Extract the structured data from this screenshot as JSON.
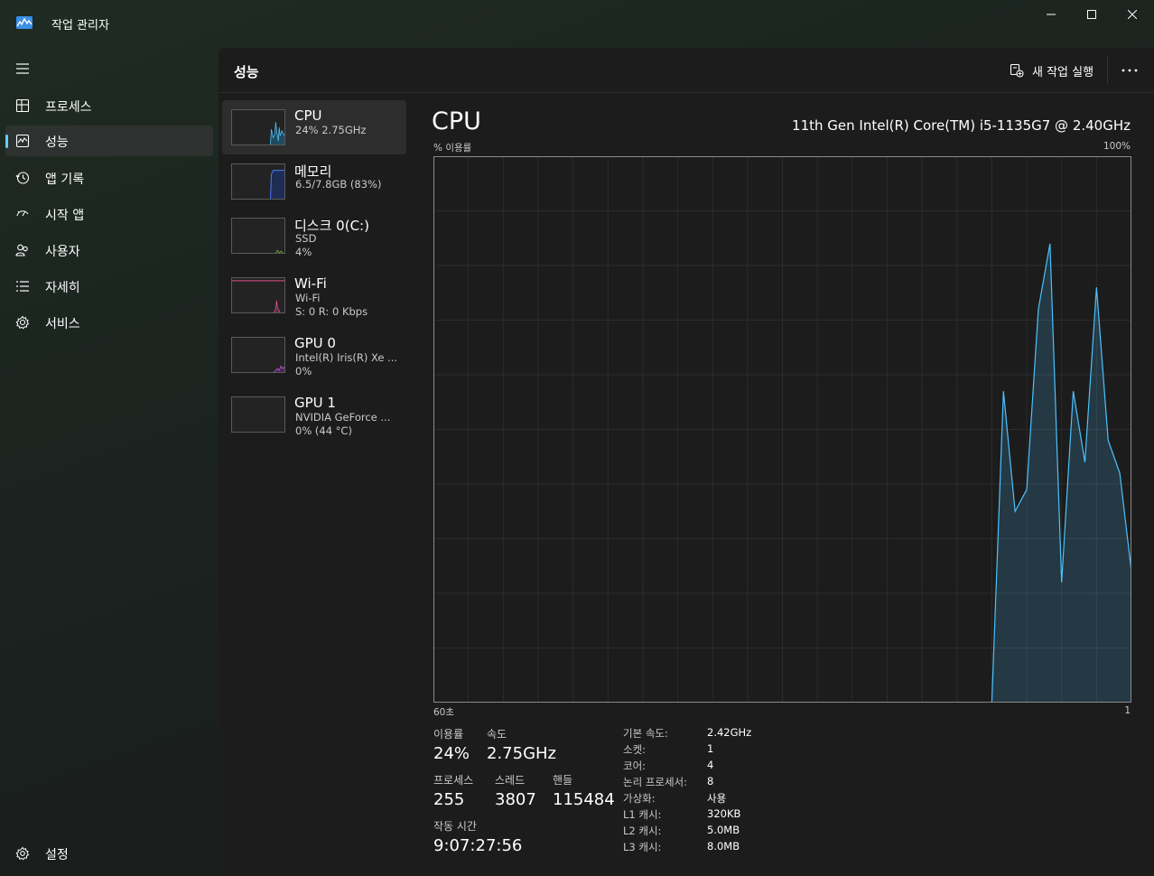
{
  "window": {
    "title": "작업 관리자"
  },
  "nav": {
    "items": [
      {
        "label": "프로세스",
        "icon": "processes-icon"
      },
      {
        "label": "성능",
        "icon": "performance-icon",
        "selected": true
      },
      {
        "label": "앱 기록",
        "icon": "history-icon"
      },
      {
        "label": "시작 앱",
        "icon": "startup-icon"
      },
      {
        "label": "사용자",
        "icon": "users-icon"
      },
      {
        "label": "자세히",
        "icon": "details-icon"
      },
      {
        "label": "서비스",
        "icon": "services-icon"
      }
    ],
    "settings_label": "설정"
  },
  "header": {
    "page_title": "성능",
    "run_task_label": "새 작업 실행"
  },
  "devices": [
    {
      "name": "CPU",
      "sub1": "24% 2.75GHz",
      "sub2": "",
      "color": "#4cc2ff",
      "selected": true
    },
    {
      "name": "메모리",
      "sub1": "6.5/7.8GB (83%)",
      "sub2": "",
      "color": "#4a7bff"
    },
    {
      "name": "디스크 0(C:)",
      "sub1": "SSD",
      "sub2": "4%",
      "color": "#7fb33f"
    },
    {
      "name": "Wi-Fi",
      "sub1": "Wi-Fi",
      "sub2": "S: 0 R: 0 Kbps",
      "color": "#e0508e"
    },
    {
      "name": "GPU 0",
      "sub1": "Intel(R) Iris(R) Xe ...",
      "sub2": "0%",
      "color": "#c25fd6"
    },
    {
      "name": "GPU 1",
      "sub1": "NVIDIA GeForce ...",
      "sub2": "0% (44 °C)",
      "color": "#c25fd6"
    }
  ],
  "detail": {
    "title": "CPU",
    "model": "11th Gen Intel(R) Core(TM) i5-1135G7 @ 2.40GHz",
    "graph_label_tl": "% 이용률",
    "graph_label_tr": "100%",
    "graph_label_bl": "60초",
    "graph_label_br": "1",
    "accent_color": "#4cc2ff",
    "stats": {
      "usage_label": "이용률",
      "usage_value": "24%",
      "speed_label": "속도",
      "speed_value": "2.75GHz",
      "processes_label": "프로세스",
      "processes_value": "255",
      "threads_label": "스레드",
      "threads_value": "3807",
      "handles_label": "핸들",
      "handles_value": "115484",
      "uptime_label": "작동 시간",
      "uptime_value": "9:07:27:56"
    },
    "specs": [
      {
        "label": "기본 속도:",
        "value": "2.42GHz"
      },
      {
        "label": "소켓:",
        "value": "1"
      },
      {
        "label": "코어:",
        "value": "4"
      },
      {
        "label": "논리 프로세서:",
        "value": "8"
      },
      {
        "label": "가상화:",
        "value": "사용"
      },
      {
        "label": "L1 캐시:",
        "value": "320KB"
      },
      {
        "label": "L2 캐시:",
        "value": "5.0MB"
      },
      {
        "label": "L3 캐시:",
        "value": "8.0MB"
      }
    ]
  },
  "chart_data": {
    "type": "area",
    "x": [
      60,
      59,
      58,
      57,
      56,
      55,
      54,
      53,
      52,
      51,
      50,
      49,
      48,
      47,
      46,
      45,
      44,
      43,
      42,
      41,
      40,
      39,
      38,
      37,
      36,
      35,
      34,
      33,
      32,
      31,
      30,
      29,
      28,
      27,
      26,
      25,
      24,
      23,
      22,
      21,
      20,
      19,
      18,
      17,
      16,
      15,
      14,
      13,
      12,
      11,
      10,
      9,
      8,
      7,
      6,
      5,
      4,
      3,
      2,
      1
    ],
    "values": [
      0,
      0,
      0,
      0,
      0,
      0,
      0,
      0,
      0,
      0,
      0,
      0,
      0,
      0,
      0,
      0,
      0,
      0,
      0,
      0,
      0,
      0,
      0,
      0,
      0,
      0,
      0,
      0,
      0,
      0,
      0,
      0,
      0,
      0,
      0,
      0,
      0,
      0,
      0,
      0,
      0,
      0,
      0,
      0,
      0,
      0,
      0,
      0,
      0,
      57,
      35,
      39,
      72,
      84,
      22,
      57,
      44,
      76,
      48,
      42,
      24
    ],
    "xlabel": "60초",
    "ylabel": "% 이용률",
    "ylim": [
      0,
      100
    ],
    "grid": true
  }
}
